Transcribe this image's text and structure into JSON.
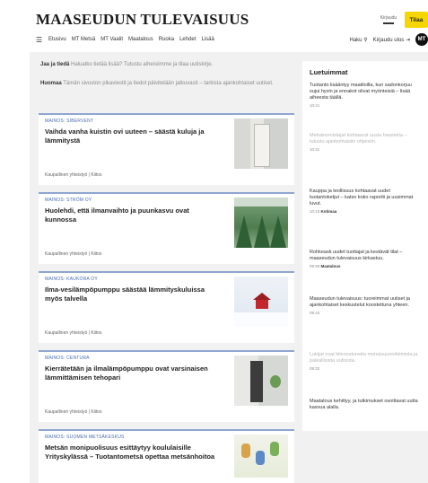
{
  "header": {
    "logo": "MAASEUDUN TULEVAISUUS",
    "login_label": "Kirjaudu",
    "subscribe_label": "Tilaa"
  },
  "nav": {
    "items": [
      "Etusivu",
      "MT Metsä",
      "MT Vaalit",
      "Maatalous",
      "Ruoka",
      "Lehdet",
      "Lisää"
    ],
    "search_label": "Haku",
    "user_label": "Kirjaudu ulos",
    "avatar_initials": "MT"
  },
  "notices": {
    "n1_bold": "Jaa ja tiedä",
    "n1_text": "Haluatko tietää lisää? Tutustu aiheisiimme ja tilaa uutiskirje.",
    "n2_bold": "Huomaa",
    "n2_text": "Tämän sivuston pikaviestit ja tiedot päivitetään jatkuvasti – tarkista ajankohtaiset uutiset."
  },
  "articles": [
    {
      "kicker": "MAINOS: SIBERVENT",
      "headline": "Vaihda vanha kuistin ovi uuteen – säästä kuluja ja lämmitystä",
      "footer": "Kaupallinen yhteistyö | Kiitos"
    },
    {
      "kicker": "MAINOS: STRÖM OY",
      "headline": "Huolehdi, että ilmanvaihto ja puunkasvu ovat kunnossa",
      "footer": "Kaupallinen yhteistyö | Kiitos"
    },
    {
      "kicker": "MAINOS: KAUKORA OY",
      "headline": "Ilma-vesilämpöpumppu säästää lämmityskuluissa myös talvella",
      "footer": "Kaupallinen yhteistyö | Kiitos"
    },
    {
      "kicker": "MAINOS: CENTURA",
      "headline": "Kierrätetään ja ilmalämpöpumppu ovat varsinaisen lämmittämisen tehopari",
      "footer": "Kaupallinen yhteistyö | Kiitos"
    },
    {
      "kicker": "MAINOS: SUOMEN METSÄKESKUS",
      "headline": "Metsän monipuolisuus esittäytyy koululaisille Yrityskylässä – Tuotantometsä opettaa metsänhoitoa",
      "footer": ""
    }
  ],
  "sidebar": {
    "title": "Luetuimmat",
    "items": [
      {
        "text": "Tuotanto lisääntyy maatiloilla, kun sadonkorjuu sujui hyvin ja ennakot olivat myönteisiä – lisää aiheesta täällä.",
        "time": "10:41",
        "tag": "",
        "faded": false
      },
      {
        "text": "Metsänomistajat kohtaavat uusia haasteita – tutustu ajankohtaisiin ohjeisiin.",
        "time": "10:31",
        "tag": "",
        "faded": true
      },
      {
        "text": "Kauppa ja teollisuus kohtaavat uudet tuotantoketjut – katso koko raportti ja uusimmat luvut.",
        "time": "10:16",
        "tag": "Kotimaa",
        "faded": false
      },
      {
        "text": "Rohkeasti uudet tuottajat ja kestävät tilat – maaseudun tulevaisuus kirkastuu.",
        "time": "09:58",
        "tag": "Maatalous",
        "faded": false
      },
      {
        "text": "Maaseudun tulevaisuus: tuoreimmat uutiset ja ajankohtaiset keskustelut koostettuna yhteen.",
        "time": "09:44",
        "tag": "",
        "faded": false
      },
      {
        "text": "Lukijat ovat kiinnostuneita metsäsuunnitelmista ja paikallisista uutisista.",
        "time": "09:32",
        "tag": "",
        "faded": true
      },
      {
        "text": "Maatalous kehittyy, ja tutkimukset osoittavat uutta kasvua alalla.",
        "time": "",
        "tag": "",
        "faded": false
      }
    ]
  }
}
